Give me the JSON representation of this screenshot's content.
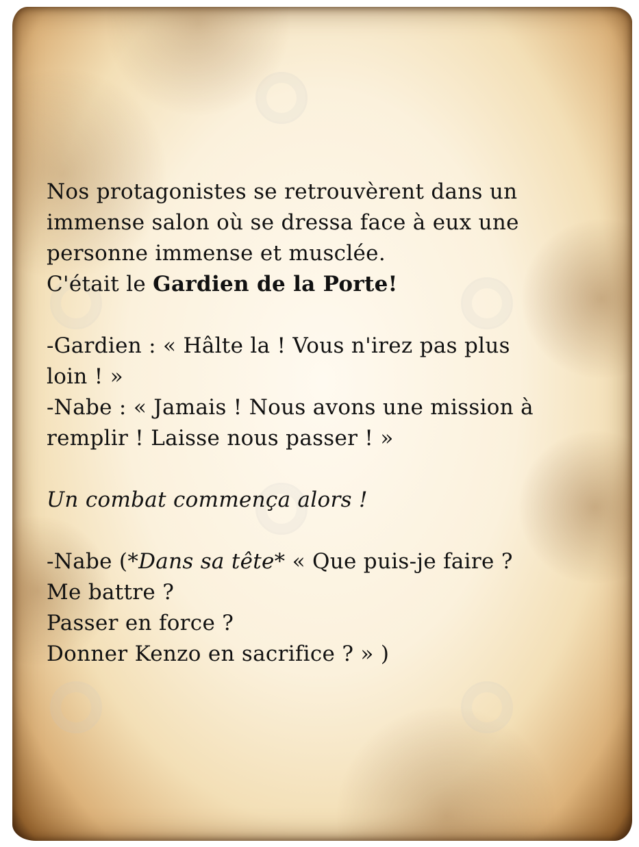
{
  "story": {
    "line1": "Nos protagonistes se retrouvèrent dans un",
    "line2": "immense salon où se dressa face à eux une",
    "line3": "personne immense et musclée.",
    "line4_prefix": "C'était le ",
    "line4_bold": "Gardien de la Porte!",
    "line5": "-Gardien : « Hâlte la ! Vous n'irez pas plus",
    "line6": "loin ! »",
    "line7": "-Nabe : « Jamais ! Nous avons une mission à",
    "line8": "remplir ! Laisse nous passer ! »",
    "line9": "Un combat commença alors !",
    "line10_prefix": "-Nabe (",
    "line10_italic": "*Dans sa tête*",
    "line10_suffix": " « Que puis-je faire ?",
    "line11": "Me battre ?",
    "line12": "Passer en force ?",
    "line13": "Donner Kenzo en sacrifice ? » )"
  }
}
